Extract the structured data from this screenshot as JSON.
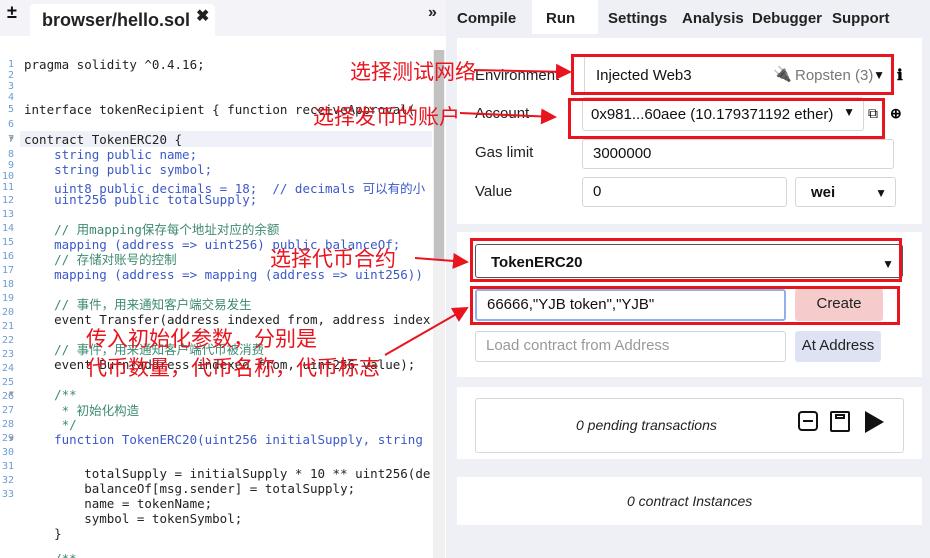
{
  "editor": {
    "expand_symbol": "±",
    "file_tab": "browser/hello.sol",
    "close_symbol": "✖",
    "collapse_symbol": "»",
    "line_numbers": [
      "1",
      "2",
      "3",
      "4",
      "5",
      "6",
      "7",
      "8",
      "9",
      "10",
      "11",
      "12",
      "13",
      "14",
      "15",
      "16",
      "17",
      "18",
      "19",
      "20",
      "21",
      "22",
      "23",
      "24",
      "25",
      "26",
      "27",
      "28",
      "29",
      "30",
      "31",
      "32",
      "33"
    ],
    "code": {
      "l1": "pragma solidity ^0.4.16;",
      "l4": "interface tokenRecipient { function receiveApproval(",
      "l6": "contract TokenERC20 {",
      "l7": "    string public name;",
      "l8": "    string public symbol;",
      "l9": "    uint8 public decimals = 18;  // decimals 可以有的小",
      "l10": "    uint256 public totalSupply;",
      "l12": "    // 用mapping保存每个地址对应的余额",
      "l13": "    mapping (address => uint256) public balanceOf;",
      "l14": "    // 存储对账号的控制",
      "l15": "    mapping (address => mapping (address => uint256))",
      "l17": "    // 事件，用来通知客户端交易发生",
      "l18": "    event Transfer(address indexed from, address index",
      "l20": "    // 事件，用来通知客户端代币被消费",
      "l21": "    event Burn(address indexed from, uint256 value);",
      "l23": "    /**",
      "l24": "     * 初始化构造",
      "l25": "     */",
      "l26": "    function TokenERC20(uint256 initialSupply, string",
      "l28": "        totalSupply = initialSupply * 10 ** uint256(de",
      "l29": "        balanceOf[msg.sender] = totalSupply;",
      "l30": "        name = tokenName;",
      "l31": "        symbol = tokenSymbol;",
      "l32": "    }",
      "l34": "    /**"
    }
  },
  "tabs": [
    "Compile",
    "Run",
    "Settings",
    "Analysis",
    "Debugger",
    "Support"
  ],
  "run": {
    "environment_label": "Environment",
    "environment_value": "Injected Web3",
    "network": "Ropsten (3)",
    "info_icon": "ℹ",
    "account_label": "Account",
    "account_value": "0x981...60aee (10.179371192 ether)",
    "gas_limit_label": "Gas limit",
    "gas_limit_value": "3000000",
    "value_label": "Value",
    "value_value": "0",
    "value_unit": "wei",
    "contract_select": "TokenERC20",
    "constructor_args": "66666,\"YJB token\",\"YJB\"",
    "create_button": "Create",
    "at_address_placeholder": "Load contract from Address",
    "at_address_button": "At Address",
    "pending": "0 pending transactions",
    "instances": "0 contract Instances"
  },
  "annotations": {
    "network": "选择测试网络",
    "account": "选择发币的账户",
    "contract": "选择代币合约",
    "params_line1": "传入初始化参数，分别是",
    "params_line2": "代币数量，代币名称，代币标志"
  },
  "colors": {
    "annotation_red": "#e8141e",
    "create_button_bg": "#f6cbcb",
    "at_address_bg": "#dde3f3"
  }
}
